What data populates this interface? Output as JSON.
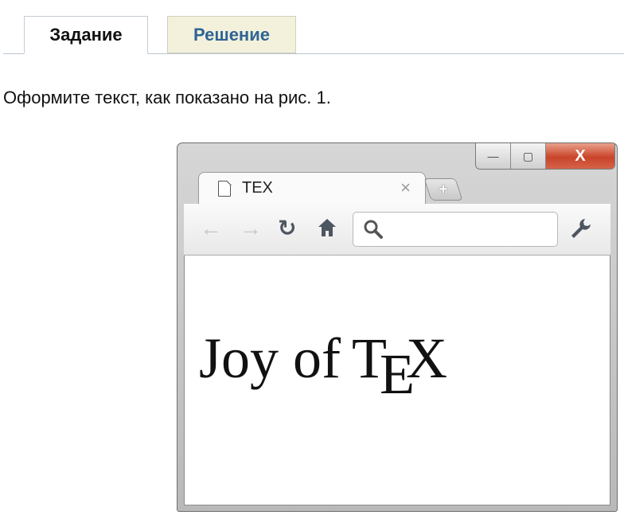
{
  "tabs": {
    "task_label": "Задание",
    "solution_label": "Решение"
  },
  "task": {
    "text": "Оформите текст, как показано на рис. 1."
  },
  "browser": {
    "tab_title": "TEX",
    "tab_close": "×",
    "new_tab": "+",
    "controls": {
      "minimize": "—",
      "maximize": "▢",
      "close": "X"
    },
    "toolbar": {
      "back_icon": "arrow-left-icon",
      "forward_icon": "arrow-right-icon",
      "reload_icon": "reload-icon",
      "home_icon": "home-icon",
      "search_icon": "search-icon",
      "wrench_icon": "wrench-icon",
      "address_value": ""
    },
    "page": {
      "prefix": "Joy of",
      "tex_t": "T",
      "tex_e": "E",
      "tex_x": "X"
    }
  },
  "colors": {
    "solution_tab_bg": "#f3f1dc",
    "solution_tab_text": "#2e6496",
    "close_button": "#c9442a"
  }
}
